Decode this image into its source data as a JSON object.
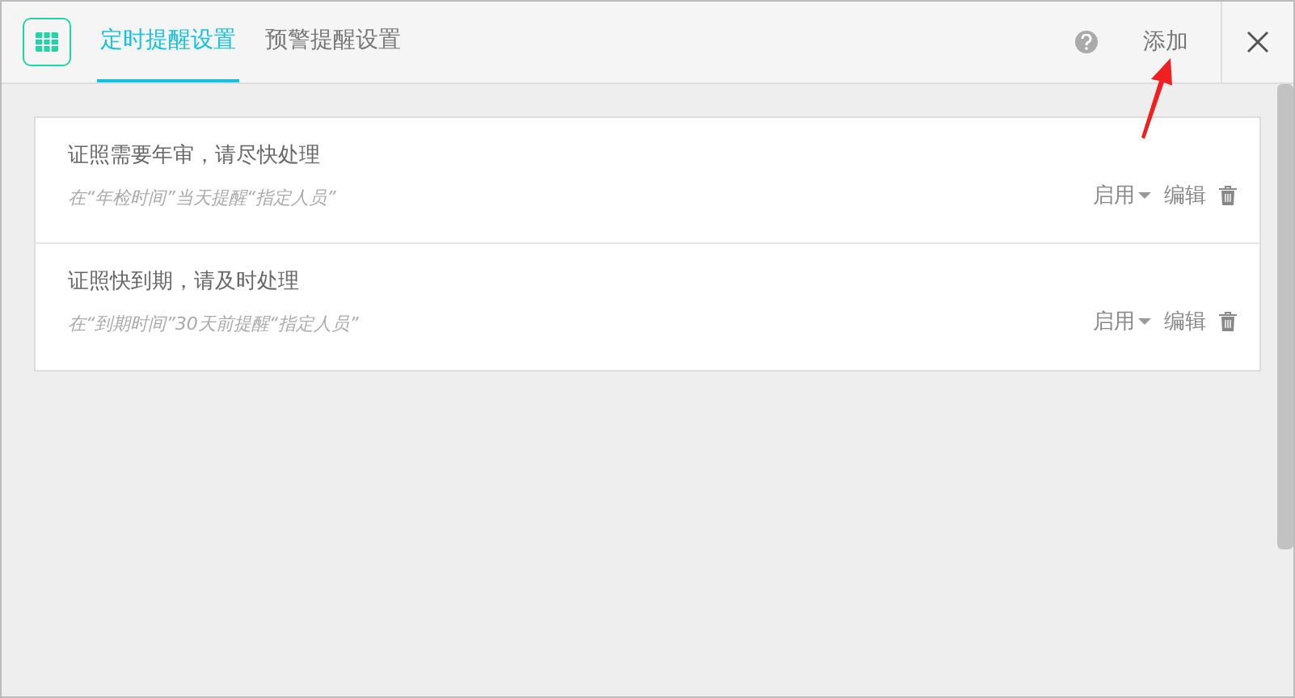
{
  "tabs": [
    {
      "label": "定时提醒设置",
      "selected": true
    },
    {
      "label": "预警提醒设置",
      "selected": false
    }
  ],
  "add_button": "添加",
  "rules": [
    {
      "title": "证照需要年审，请尽快处理",
      "description": "在“年检时间”当天提醒“指定人员”",
      "status": "启用",
      "edit": "编辑"
    },
    {
      "title": "证照快到期，请及时处理",
      "description": "在“到期时间”30天前提醒“指定人员”",
      "status": "启用",
      "edit": "编辑"
    }
  ]
}
